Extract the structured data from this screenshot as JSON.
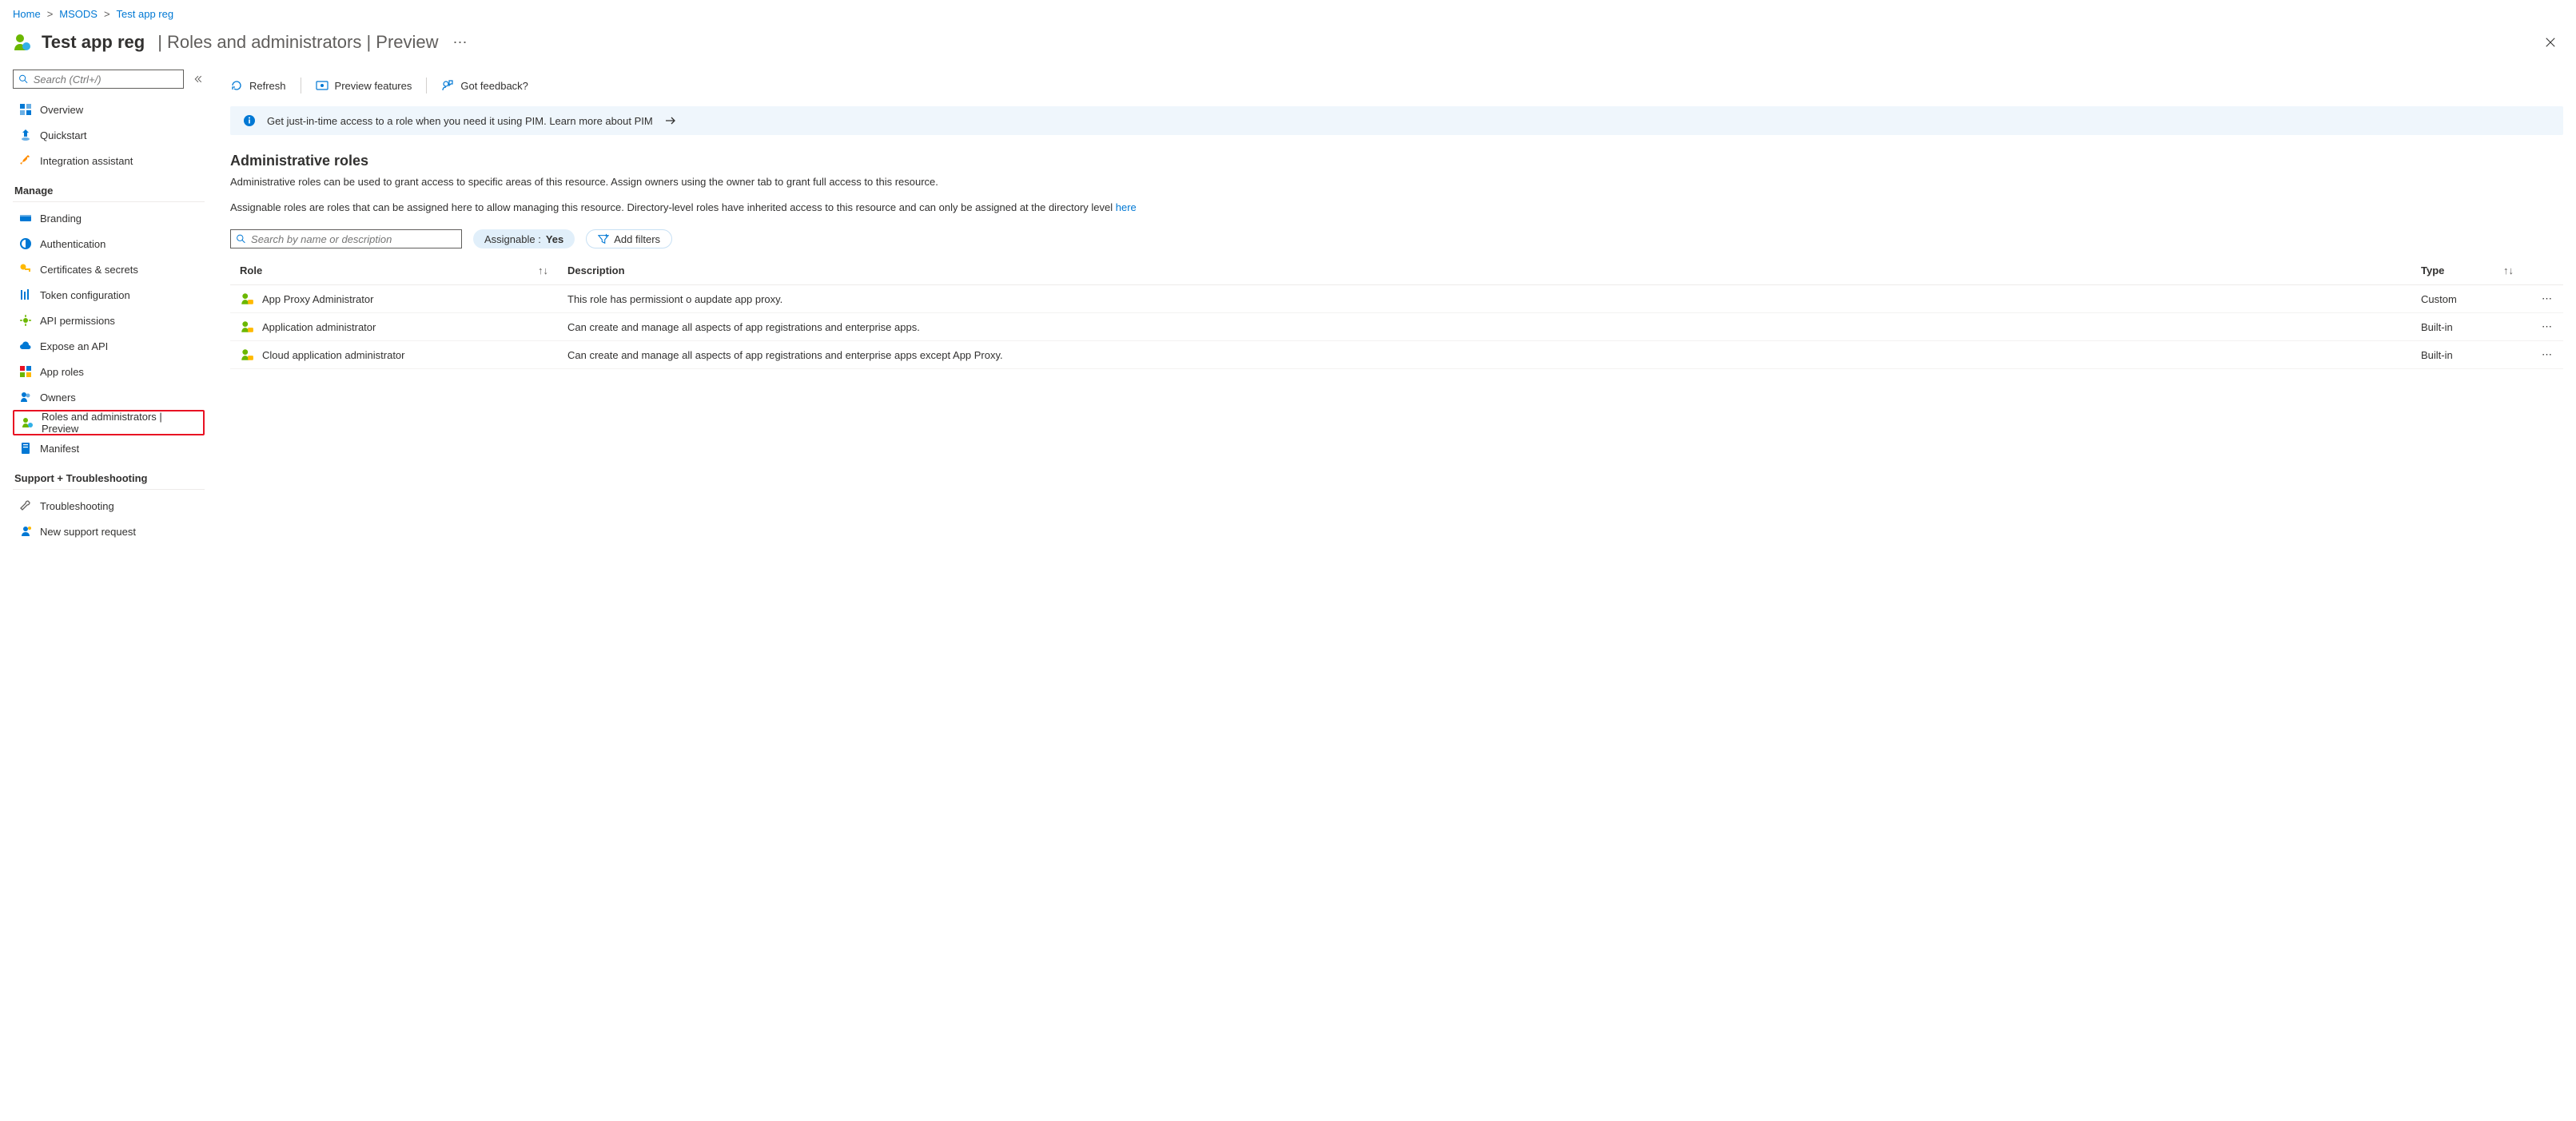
{
  "breadcrumb": [
    "Home",
    "MSODS",
    "Test app reg"
  ],
  "header": {
    "title": "Test app reg",
    "subtitle": "Roles and administrators | Preview"
  },
  "sidebar": {
    "search_placeholder": "Search (Ctrl+/)",
    "top": [
      {
        "label": "Overview"
      },
      {
        "label": "Quickstart"
      },
      {
        "label": "Integration assistant"
      }
    ],
    "groups": [
      {
        "header": "Manage",
        "items": [
          {
            "label": "Branding"
          },
          {
            "label": "Authentication"
          },
          {
            "label": "Certificates & secrets"
          },
          {
            "label": "Token configuration"
          },
          {
            "label": "API permissions"
          },
          {
            "label": "Expose an API"
          },
          {
            "label": "App roles"
          },
          {
            "label": "Owners"
          },
          {
            "label": "Roles and administrators | Preview",
            "highlight": true
          },
          {
            "label": "Manifest"
          }
        ]
      },
      {
        "header": "Support + Troubleshooting",
        "items": [
          {
            "label": "Troubleshooting"
          },
          {
            "label": "New support request"
          }
        ]
      }
    ]
  },
  "commands": {
    "refresh": "Refresh",
    "preview": "Preview features",
    "feedback": "Got feedback?"
  },
  "banner": {
    "text": "Get just-in-time access to a role when you need it using PIM. Learn more about PIM"
  },
  "section": {
    "title": "Administrative roles",
    "desc1": "Administrative roles can be used to grant access to specific areas of this resource. Assign owners using the owner tab to grant full access to this resource.",
    "desc2_pre": "Assignable roles are roles that can be assigned here to allow managing this resource. Directory-level roles have inherited access to this resource and can only be assigned at the directory level ",
    "desc2_link": "here"
  },
  "filters": {
    "search_placeholder": "Search by name or description",
    "assignable_label": "Assignable : ",
    "assignable_value": "Yes",
    "add_filters": "Add filters"
  },
  "table": {
    "columns": {
      "role": "Role",
      "description": "Description",
      "type": "Type"
    },
    "rows": [
      {
        "role": "App Proxy Administrator",
        "description": "This role has permissiont o aupdate app proxy.",
        "type": "Custom"
      },
      {
        "role": "Application administrator",
        "description": "Can create and manage all aspects of app registrations and enterprise apps.",
        "type": "Built-in"
      },
      {
        "role": "Cloud application administrator",
        "description": "Can create and manage all aspects of app registrations and enterprise apps except App Proxy.",
        "type": "Built-in"
      }
    ]
  }
}
